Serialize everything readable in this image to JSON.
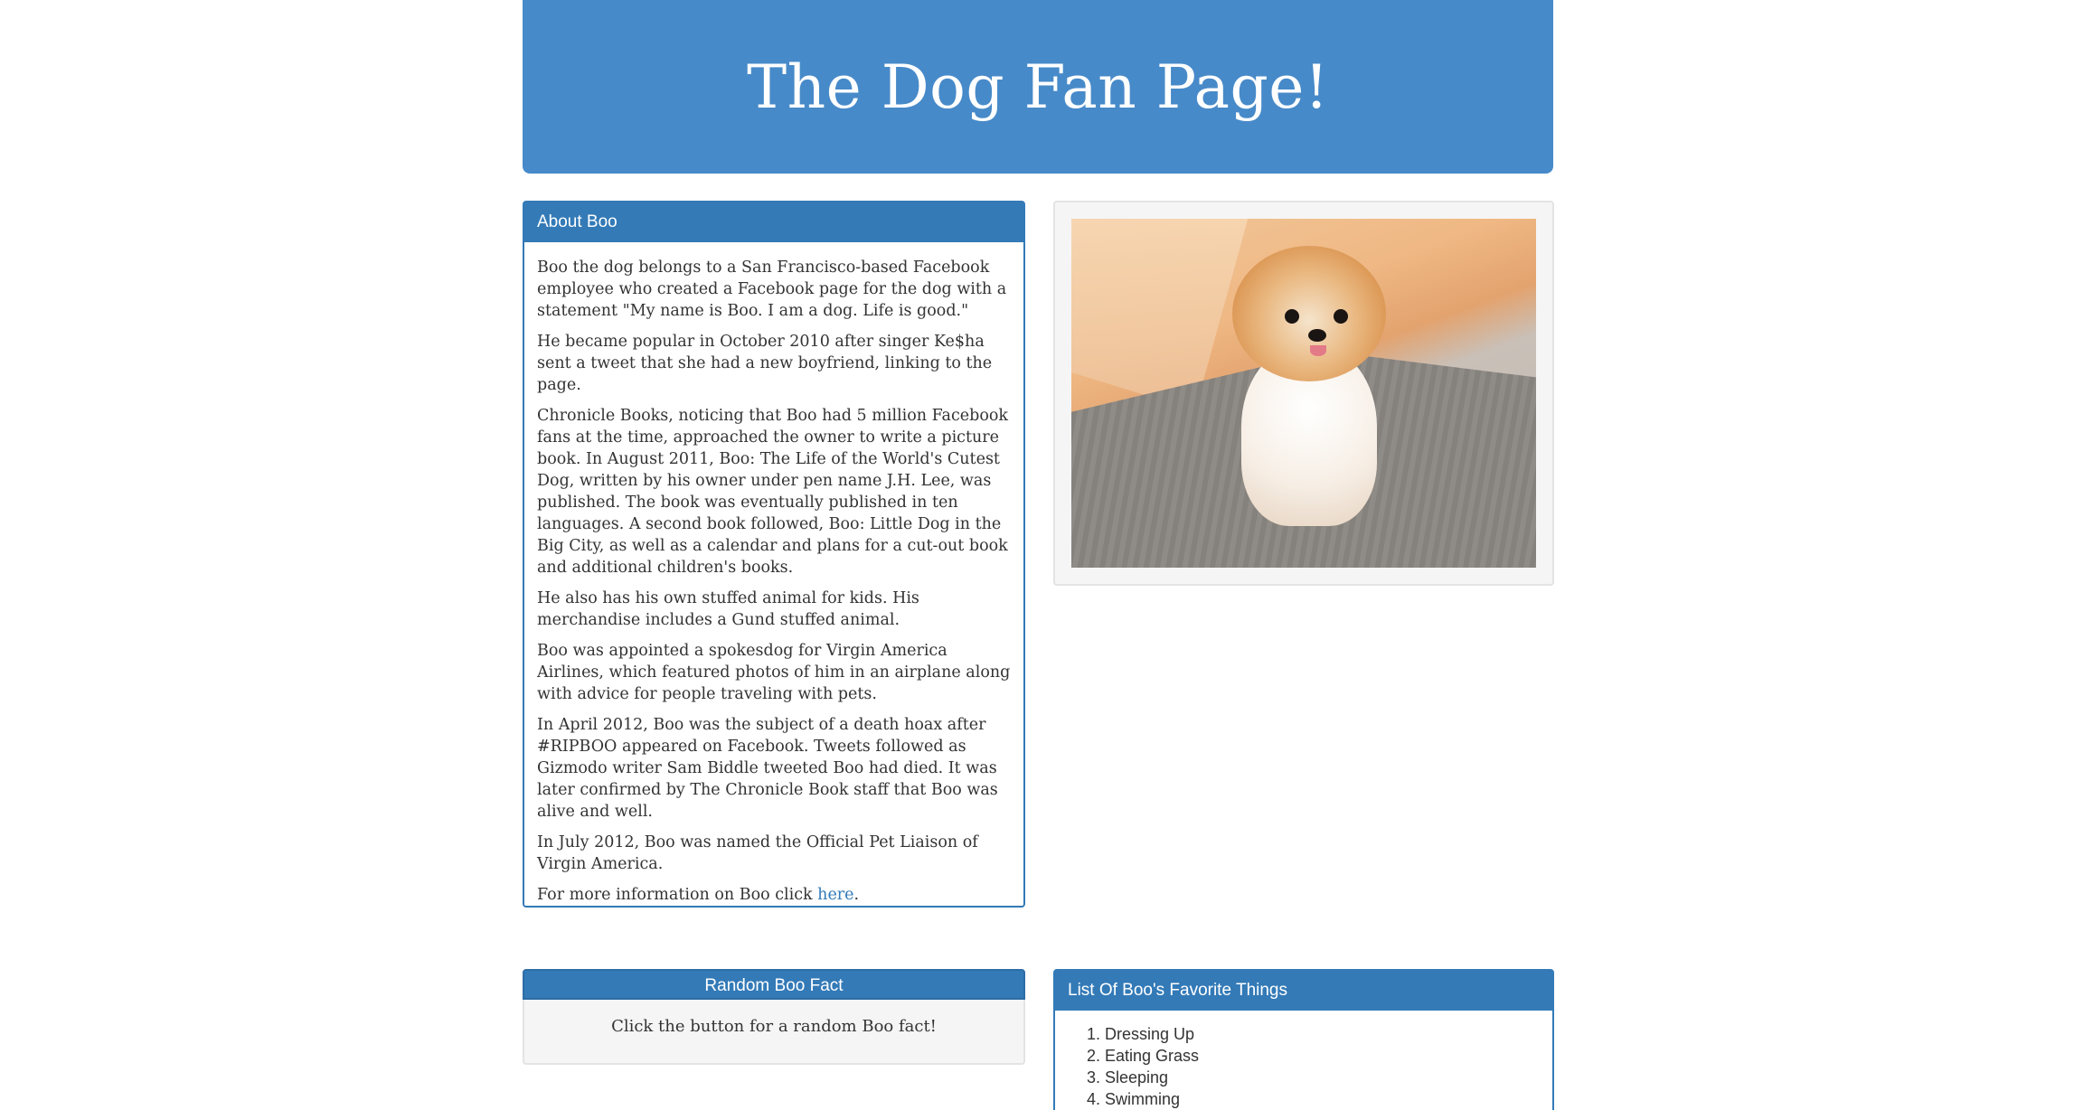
{
  "header": {
    "title": "The Dog Fan Page!"
  },
  "about": {
    "heading": "About Boo",
    "paragraphs": [
      "Boo the dog belongs to a San Francisco-based Facebook employee who created a Facebook page for the dog with a statement \"My name is Boo. I am a dog. Life is good.\"",
      "He became popular in October 2010 after singer Ke$ha sent a tweet that she had a new boyfriend, linking to the page.",
      "Chronicle Books, noticing that Boo had 5 million Facebook fans at the time, approached the owner to write a picture book. In August 2011, Boo: The Life of the World's Cutest Dog, written by his owner under pen name J.H. Lee, was published. The book was eventually published in ten languages. A second book followed, Boo: Little Dog in the Big City, as well as a calendar and plans for a cut-out book and additional children's books.",
      "He also has his own stuffed animal for kids. His merchandise includes a Gund stuffed animal.",
      "Boo was appointed a spokesdog for Virgin America Airlines, which featured photos of him in an airplane along with advice for people traveling with pets.",
      "In April 2012, Boo was the subject of a death hoax after #RIPBOO appeared on Facebook. Tweets followed as Gizmodo writer Sam Biddle tweeted Boo had died. It was later confirmed by The Chronicle Book staff that Boo was alive and well.",
      "In July 2012, Boo was named the Official Pet Liaison of Virgin America."
    ],
    "more_info_prefix": "For more information on Boo click ",
    "more_info_link": "here",
    "more_info_suffix": "."
  },
  "random_fact": {
    "heading": "Random Boo Fact",
    "text": "Click the button for a random Boo fact!"
  },
  "favorites": {
    "heading": "List Of Boo's Favorite Things",
    "items": [
      "Dressing Up",
      "Eating Grass",
      "Sleeping",
      "Swimming"
    ]
  }
}
